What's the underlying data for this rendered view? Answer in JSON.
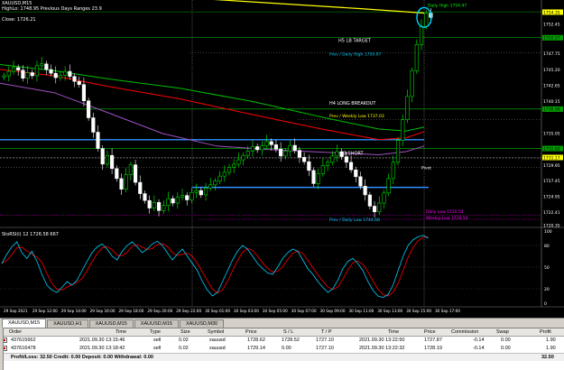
{
  "chart": {
    "symbol_line": "XAUUSD,M15",
    "info_lines": [
      "HighLo: 1748.95    Previous Days Ranges 23.9",
      "Close: 1726.21"
    ],
    "sub_indicator_label": "StoRSI(i) 12 1726.58 667",
    "price_labels": [
      {
        "text": "1754.35",
        "price": 1754.35,
        "color": "#ffff00"
      },
      {
        "text": "1752.45",
        "price": 1752.45,
        "color": "#ffffff"
      },
      {
        "text": "1750.27",
        "price": 1750.27,
        "color": "#00a000"
      },
      {
        "text": "1747.75",
        "price": 1747.75,
        "color": "#ffffff"
      },
      {
        "text": "1745.20",
        "price": 1745.2,
        "color": "#ffffff"
      },
      {
        "text": "1742.65",
        "price": 1742.65,
        "color": "#ffffff"
      },
      {
        "text": "1740.15",
        "price": 1740.15,
        "color": "#ffffff"
      },
      {
        "text": "1738.88",
        "price": 1738.88,
        "color": "#00a000"
      },
      {
        "text": "1735.05",
        "price": 1735.05,
        "color": "#ffffff"
      },
      {
        "text": "1732.60",
        "price": 1732.6,
        "color": "#00a000"
      },
      {
        "text": "1731.17",
        "price": 1731.17,
        "color": "#ffff00"
      },
      {
        "text": "1729.95",
        "price": 1729.95,
        "color": "#ffffff"
      },
      {
        "text": "1727.45",
        "price": 1727.45,
        "color": "#ffffff"
      },
      {
        "text": "1724.95",
        "price": 1724.95,
        "color": "#ffffff"
      },
      {
        "text": "1722.41",
        "price": 1722.41,
        "color": "#ffffff"
      },
      {
        "text": "1720.35",
        "price": 1720.35,
        "color": "#ffffff"
      }
    ],
    "time_labels": [
      "29 Sep 2021",
      "29 Sep 12:00",
      "29 Sep 14:00",
      "29 Sep 16:00",
      "29 Sep 18:00",
      "29 Sep 20:00",
      "29 Sep 22:00",
      "30 Sep 01:00",
      "30 Sep 03:00",
      "30 Sep 05:00",
      "30 Sep 07:00",
      "30 Sep 09:00",
      "30 Sep 11:00",
      "30 Sep 13:00",
      "30 Sep 15:00",
      "30 Sep 17:00"
    ],
    "annotations": {
      "daily_high": "Daily High 1754.47",
      "h5_target": "H5 LB TARGET",
      "prev_daily_high": "Prev / Daily High 1750.97",
      "h4_breakout": "H4 LONG BREAKOUT",
      "prev_weekly_low": "Prev / Weekly Low 1737.03",
      "l3_short": "L3 SHORT",
      "pivot": "Pivot",
      "prev_daily_low": "Prev / Daily Low 1744.68",
      "daily_low": "Daily Low 1720.54",
      "weekly_low": "Weekly Low 1720.54"
    },
    "colors": {
      "bull": "#00ff00",
      "bear": "#ffffff",
      "ma_yellow": "#ffff00",
      "ma_red": "#ff0000",
      "ma_green": "#00c000",
      "ma_purple": "#a050c0",
      "cyan": "#00d0ff",
      "blue_line": "#3090ff",
      "magenta": "#ff00ff"
    }
  },
  "tabs": [
    "XAUUSD,M15",
    "XAUUSD,H1",
    "XAUUSD,M15",
    "XAUUSD,M15",
    "XAUUSD,M30"
  ],
  "terminal": {
    "headers": [
      "Order",
      "Time",
      "Type",
      "Size",
      "Symbol",
      "Price",
      "S / L",
      "T / P",
      "Time",
      "Price",
      "Commission",
      "Swap",
      "Profit"
    ],
    "rows": [
      [
        "437615662",
        "2021.09.30 13:15:46",
        "sell",
        "0.02",
        "xauusd",
        "1728.62",
        "1728.52",
        "1727.10",
        "2021.09.30 13:22:50",
        "1727.87",
        "-0.14",
        "0.00",
        "1.90"
      ],
      [
        "437616478",
        "2021.09.30 13:18:42",
        "sell",
        "0.02",
        "xauusd",
        "1729.14",
        "0.00",
        "1727.10",
        "2021.09.30 13:22:32",
        "1728.19",
        "-0.14",
        "0.00",
        "1.90"
      ]
    ],
    "summary": "Profit/Loss: 32.50  Credit: 0.00  Deposit: 0.00  Withdrawal: 0.00",
    "total": "32.50"
  }
}
